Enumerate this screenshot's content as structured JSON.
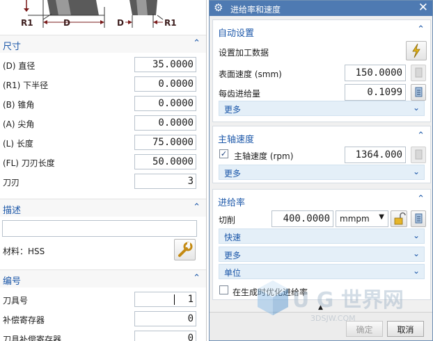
{
  "diagram": {
    "r1_left": "R1",
    "d_left": "D",
    "d_right": "D",
    "r1_right": "R1"
  },
  "left": {
    "dimensions": {
      "title": "尺寸",
      "rows": [
        {
          "label": "(D) 直径",
          "value": "35.0000"
        },
        {
          "label": "(R1) 下半径",
          "value": "0.0000"
        },
        {
          "label": "(B) 锥角",
          "value": "0.0000"
        },
        {
          "label": "(A) 尖角",
          "value": "0.0000"
        },
        {
          "label": "(L) 长度",
          "value": "75.0000"
        },
        {
          "label": "(FL) 刀刃长度",
          "value": "50.0000"
        },
        {
          "label": "刀刃",
          "value": "3"
        }
      ]
    },
    "description": {
      "title": "描述",
      "input_value": "",
      "material_label": "材料：HSS"
    },
    "numbering": {
      "title": "编号",
      "rows": [
        {
          "label": "刀具号",
          "value": "1"
        },
        {
          "label": "补偿寄存器",
          "value": "0"
        },
        {
          "label": "刀具补偿寄存器",
          "value": "0"
        }
      ]
    }
  },
  "dialog": {
    "title": "进给率和速度",
    "auto": {
      "title": "自动设置",
      "set_data_label": "设置加工数据",
      "surface_speed_label": "表面速度 (smm)",
      "surface_speed_value": "150.0000",
      "feed_per_tooth_label": "每齿进给量",
      "feed_per_tooth_value": "0.1099",
      "more_label": "更多"
    },
    "spindle": {
      "title": "主轴速度",
      "spindle_label": "主轴速度 (rpm)",
      "spindle_checked": true,
      "spindle_value": "1364.000",
      "more_label": "更多"
    },
    "feed": {
      "title": "进给率",
      "cut_label": "切削",
      "cut_value": "400.0000",
      "unit_value": "mmpm",
      "rapid_label": "快速",
      "more_label": "更多",
      "units_label": "单位",
      "optimize_label": "在生成时优化进给率",
      "optimize_checked": false
    },
    "footer": {
      "ok_label": "确定",
      "cancel_label": "取消"
    }
  },
  "watermark": {
    "text": "3DSJW.COM",
    "brand": "U G 世界网"
  },
  "colors": {
    "accent": "#1a56a8",
    "titlebar": "#4e7ab2",
    "more_bg": "#e4eff8"
  }
}
